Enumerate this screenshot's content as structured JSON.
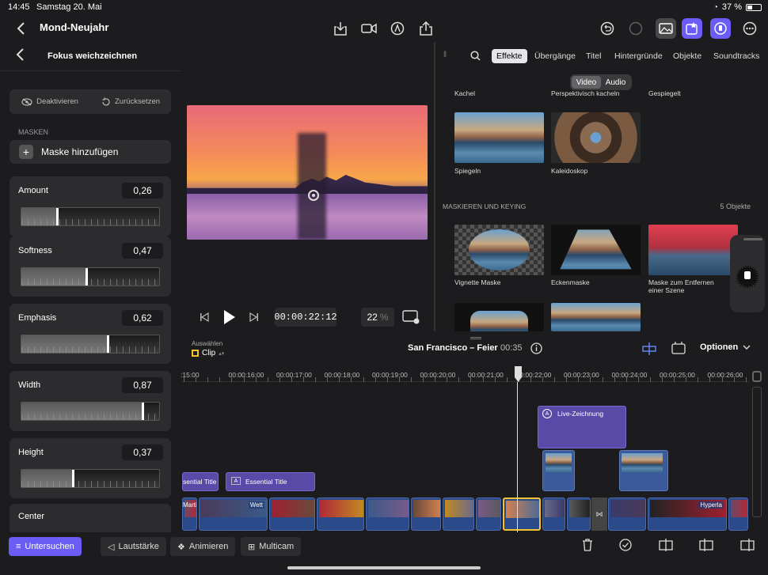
{
  "status": {
    "time": "14:45",
    "date": "Samstag 20. Mai",
    "battery": "37 %"
  },
  "toolbar": {
    "back_icon": "chevron-left-icon",
    "project_title": "Mond-Neujahr"
  },
  "inspector": {
    "title": "Fokus weichzeichnen",
    "deactivate_label": "Deaktivieren",
    "reset_label": "Zurücksetzen",
    "masks_section": "MASKEN",
    "add_mask_label": "Maske hinzufügen",
    "params": [
      {
        "label": "Amount",
        "value": "0,26",
        "level": 0.26
      },
      {
        "label": "Softness",
        "value": "0,47",
        "level": 0.47
      },
      {
        "label": "Emphasis",
        "value": "0,62",
        "level": 0.62
      },
      {
        "label": "Width",
        "value": "0,87",
        "level": 0.87
      },
      {
        "label": "Height",
        "value": "0,37",
        "level": 0.37
      }
    ],
    "center_label": "Center"
  },
  "viewer": {
    "timecode": "00:00:22:12",
    "zoom_value": "22",
    "zoom_unit": "%"
  },
  "browser": {
    "tabs": [
      "Effekte",
      "Übergänge",
      "Titel",
      "Hintergründe",
      "Objekte",
      "Soundtracks"
    ],
    "active_tab": "Effekte",
    "segment": [
      "Video",
      "Audio"
    ],
    "top_row_labels": [
      "Kachel",
      "Perspektivisch kacheln",
      "Gespiegelt"
    ],
    "row1": [
      "Spiegeln",
      "Kaleidoskop"
    ],
    "section_title": "MASKIEREN UND KEYING",
    "section_count": "5 Objekte",
    "row2": [
      "Vignette Maske",
      "Eckenmaske",
      "Maske zum Entfernen einer Szene"
    ]
  },
  "timeline": {
    "select_label": "Auswählen",
    "select_value": "Clip",
    "project_name": "San Francisco – Feier",
    "duration": "00:35",
    "options_label": "Optionen",
    "ruler": [
      ":15:00",
      "00:00:16:00",
      "00:00:17:00",
      "00:00:18:00",
      "00:00:19:00",
      "00:00:20:00",
      "00:00:21:00",
      "00:00:22:00",
      "00:00:23:00",
      "00:00:24:00",
      "00:00:25:00",
      "00:00:26:00"
    ],
    "clip_live": "Live-Zeichnung",
    "clip_title1": "sential Title",
    "clip_title2": "Essential Title",
    "clip_marti": "Marti",
    "clip_wett": "Wett",
    "clip_hyper": "Hyperla"
  },
  "bottom": {
    "inspect_label": "Untersuchen",
    "volume_label": "Lautstärke",
    "animate_label": "Animieren",
    "multicam_label": "Multicam"
  }
}
